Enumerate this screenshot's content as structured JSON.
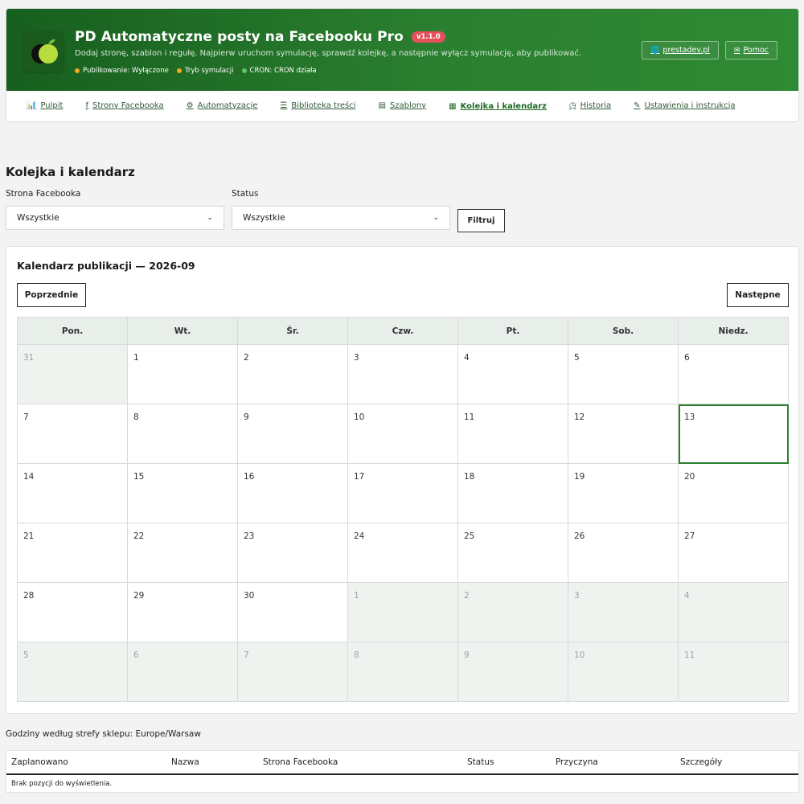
{
  "header": {
    "title": "PD Automatyczne posty na Facebooku Pro",
    "version": "v1.1.0",
    "subtitle": "Dodaj stronę, szablon i regułę. Najpierw uruchom symulację, sprawdź kolejkę, a następnie wyłącz symulację, aby publikować.",
    "statuses": [
      {
        "label": "Publikowanie: Wyłączone",
        "color": "#f5a623"
      },
      {
        "label": "Tryb symulacji",
        "color": "#f5a623"
      },
      {
        "label": "CRON: CRON działa",
        "color": "#5fc566"
      }
    ],
    "links": [
      {
        "label": "prestadev.pl",
        "icon": "globe-icon"
      },
      {
        "label": "Pomoc",
        "icon": "envelope-icon"
      }
    ]
  },
  "tabs": [
    {
      "label": "Pulpit",
      "icon": "bar-chart-icon",
      "glyph": "📊"
    },
    {
      "label": "Strony Facebooka",
      "icon": "facebook-icon",
      "glyph": "f"
    },
    {
      "label": "Automatyzacje",
      "icon": "cogs-icon",
      "glyph": "⚙"
    },
    {
      "label": "Biblioteka treści",
      "icon": "list-icon",
      "glyph": "☰"
    },
    {
      "label": "Szablony",
      "icon": "file-icon",
      "glyph": "▤"
    },
    {
      "label": "Kolejka i kalendarz",
      "icon": "calendar-icon",
      "glyph": "▦",
      "active": true
    },
    {
      "label": "Historia",
      "icon": "clock-icon",
      "glyph": "◷"
    },
    {
      "label": "Ustawienia i instrukcja",
      "icon": "wrench-icon",
      "glyph": "✎"
    }
  ],
  "page": {
    "title": "Kolejka i kalendarz",
    "filters": {
      "page_label": "Strona Facebooka",
      "page_value": "Wszystkie",
      "status_label": "Status",
      "status_value": "Wszystkie",
      "filter_button": "Filtruj"
    }
  },
  "calendar": {
    "title": "Kalendarz publikacji — 2026-09",
    "prev": "Poprzednie",
    "next": "Następne",
    "weekdays": [
      "Pon.",
      "Wt.",
      "Śr.",
      "Czw.",
      "Pt.",
      "Sob.",
      "Niedz."
    ],
    "days": [
      {
        "d": "31",
        "other": true
      },
      {
        "d": "1"
      },
      {
        "d": "2"
      },
      {
        "d": "3"
      },
      {
        "d": "4"
      },
      {
        "d": "5"
      },
      {
        "d": "6"
      },
      {
        "d": "7"
      },
      {
        "d": "8"
      },
      {
        "d": "9"
      },
      {
        "d": "10"
      },
      {
        "d": "11"
      },
      {
        "d": "12"
      },
      {
        "d": "13",
        "today": true
      },
      {
        "d": "14"
      },
      {
        "d": "15"
      },
      {
        "d": "16"
      },
      {
        "d": "17"
      },
      {
        "d": "18"
      },
      {
        "d": "19"
      },
      {
        "d": "20"
      },
      {
        "d": "21"
      },
      {
        "d": "22"
      },
      {
        "d": "23"
      },
      {
        "d": "24"
      },
      {
        "d": "25"
      },
      {
        "d": "26"
      },
      {
        "d": "27"
      },
      {
        "d": "28"
      },
      {
        "d": "29"
      },
      {
        "d": "30"
      },
      {
        "d": "1",
        "other": true
      },
      {
        "d": "2",
        "other": true
      },
      {
        "d": "3",
        "other": true
      },
      {
        "d": "4",
        "other": true
      },
      {
        "d": "5",
        "other": true
      },
      {
        "d": "6",
        "other": true
      },
      {
        "d": "7",
        "other": true
      },
      {
        "d": "8",
        "other": true
      },
      {
        "d": "9",
        "other": true
      },
      {
        "d": "10",
        "other": true
      },
      {
        "d": "11",
        "other": true
      }
    ]
  },
  "timezone_note": "Godziny według strefy sklepu: Europe/Warsaw",
  "queue_table": {
    "columns": [
      "Zaplanowano",
      "Nazwa",
      "Strona Facebooka",
      "Status",
      "Przyczyna",
      "Szczegóły"
    ],
    "empty": "Brak pozycji do wyświetlenia."
  }
}
